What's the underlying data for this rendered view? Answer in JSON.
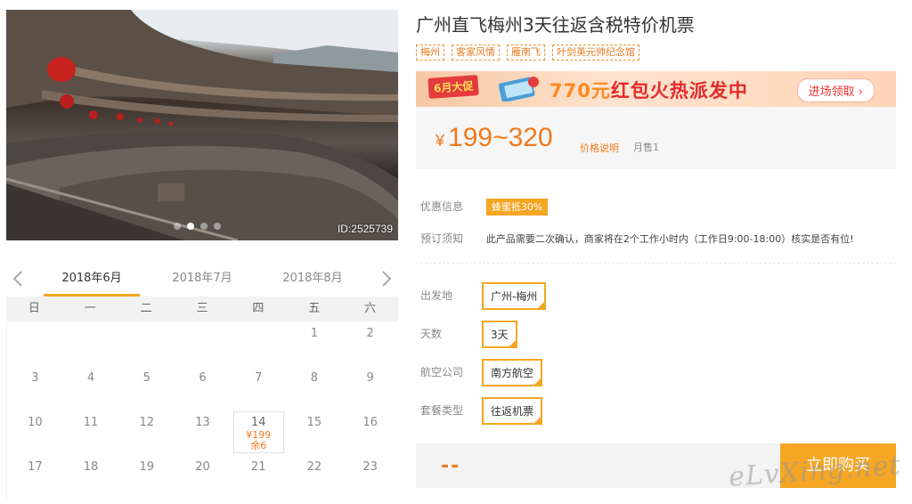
{
  "photo": {
    "id_label": "ID:2525739",
    "slide_count": 4,
    "active_slide": 1
  },
  "calendar": {
    "months": [
      "2018年6月",
      "2018年7月",
      "2018年8月"
    ],
    "active_month": 0,
    "weekdays": [
      "日",
      "一",
      "二",
      "三",
      "四",
      "五",
      "六"
    ],
    "days": [
      {
        "d": ""
      },
      {
        "d": ""
      },
      {
        "d": ""
      },
      {
        "d": ""
      },
      {
        "d": ""
      },
      {
        "d": "1"
      },
      {
        "d": "2"
      },
      {
        "d": "3"
      },
      {
        "d": "4"
      },
      {
        "d": "5"
      },
      {
        "d": "6"
      },
      {
        "d": "7"
      },
      {
        "d": "8"
      },
      {
        "d": "9"
      },
      {
        "d": "10"
      },
      {
        "d": "11"
      },
      {
        "d": "12"
      },
      {
        "d": "13"
      },
      {
        "d": "14",
        "price": "¥199",
        "left": "余6"
      },
      {
        "d": "15"
      },
      {
        "d": "16"
      },
      {
        "d": "17"
      },
      {
        "d": "18"
      },
      {
        "d": "19"
      },
      {
        "d": "20"
      },
      {
        "d": "21"
      },
      {
        "d": "22"
      },
      {
        "d": "23"
      }
    ]
  },
  "product": {
    "title": "广州直飞梅州3天往返含税特价机票",
    "tags": [
      "梅州",
      "客家风情",
      "雁南飞",
      "叶剑英元帅纪念馆"
    ]
  },
  "banner": {
    "badge": "6月大促",
    "amount": "770元",
    "text": "红包火热派发中",
    "button": "进场领取 ›"
  },
  "price": {
    "yen": "¥",
    "range": "199~320",
    "note": "价格说明",
    "sold": "月售1"
  },
  "info": {
    "discount_label": "优惠信息",
    "discount_value": "蜂蜜抵30%",
    "notice_label": "预订须知",
    "notice_value": "此产品需要二次确认，商家将在2个工作小时内（工作日9:00-18:00）核实是否有位!"
  },
  "options": [
    {
      "label": "出发地",
      "value": "广州-梅州"
    },
    {
      "label": "天数",
      "value": "3天"
    },
    {
      "label": "航空公司",
      "value": "南方航空"
    },
    {
      "label": "套餐类型",
      "value": "往返机票"
    }
  ],
  "buy": {
    "total": "--",
    "button": "立即购买"
  },
  "watermark": "eLvXing.net",
  "colors": {
    "accent": "#f5a623",
    "price": "#f07a1c",
    "banner_red": "#e52a2a"
  }
}
